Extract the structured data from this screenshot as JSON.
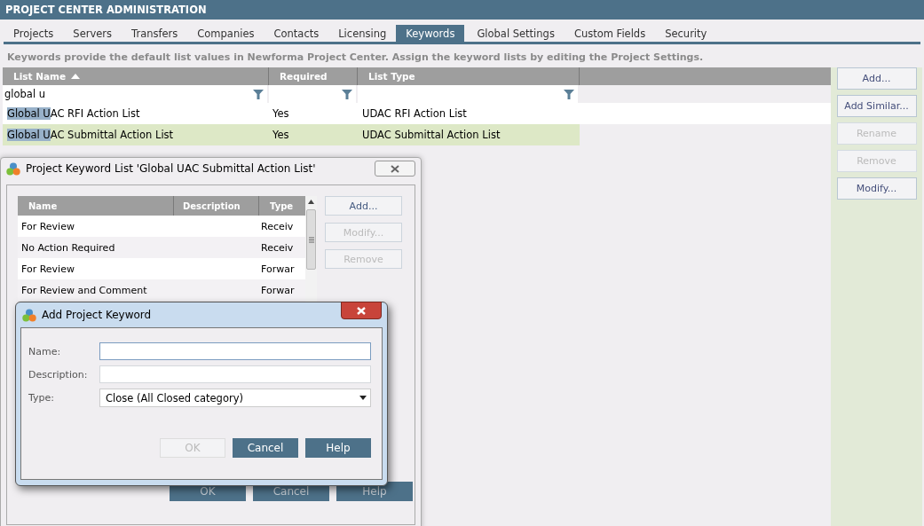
{
  "header": {
    "title": "PROJECT CENTER ADMINISTRATION"
  },
  "tabs": [
    {
      "label": "Projects",
      "selected": false
    },
    {
      "label": "Servers",
      "selected": false
    },
    {
      "label": "Transfers",
      "selected": false
    },
    {
      "label": "Companies",
      "selected": false
    },
    {
      "label": "Contacts",
      "selected": false
    },
    {
      "label": "Licensing",
      "selected": false
    },
    {
      "label": "Keywords",
      "selected": true
    },
    {
      "label": "Global Settings",
      "selected": false
    },
    {
      "label": "Custom Fields",
      "selected": false
    },
    {
      "label": "Security",
      "selected": false
    }
  ],
  "description": "Keywords provide the default list values in Newforma Project Center. Assign the keyword lists by editing the Project Settings.",
  "table": {
    "columns": [
      {
        "label": "List Name",
        "sorted": true,
        "filter": "global u"
      },
      {
        "label": "Required",
        "sorted": false
      },
      {
        "label": "List Type",
        "sorted": false
      }
    ],
    "rows": [
      {
        "selected": false,
        "cells": [
          [
            {
              "text": "Global U",
              "highlighted": true
            },
            {
              "text": "AC RFI Action List",
              "highlighted": false
            }
          ],
          [
            {
              "text": "Yes",
              "highlighted": false
            }
          ],
          [
            {
              "text": "UDAC RFI Action List",
              "highlighted": false
            }
          ]
        ]
      },
      {
        "selected": true,
        "cells": [
          [
            {
              "text": "Global U",
              "highlighted": true
            },
            {
              "text": "AC Submittal Action List",
              "highlighted": false
            }
          ],
          [
            {
              "text": "Yes",
              "highlighted": false
            }
          ],
          [
            {
              "text": "UDAC Submittal Action List",
              "highlighted": false
            }
          ]
        ]
      }
    ]
  },
  "side_buttons": [
    {
      "label": "Add...",
      "disabled": false
    },
    {
      "label": "Add Similar...",
      "disabled": false
    },
    {
      "label": "Rename",
      "disabled": true
    },
    {
      "label": "Remove",
      "disabled": true
    },
    {
      "label": "Modify...",
      "disabled": false
    }
  ],
  "list_dialog": {
    "title": "Project Keyword List 'Global UAC Submittal Action List'",
    "columns": [
      "Name",
      "Description",
      "Type"
    ],
    "rows": [
      {
        "name": "For Review",
        "type": "Receiv"
      },
      {
        "name": "No Action Required",
        "type": "Receiv"
      },
      {
        "name": "For Review",
        "type": "Forwar"
      },
      {
        "name": "For Review and Comment",
        "type": "Forwar"
      }
    ],
    "buttons": [
      {
        "label": "Add...",
        "disabled": false
      },
      {
        "label": "Modify...",
        "disabled": true
      },
      {
        "label": "Remove",
        "disabled": true
      }
    ],
    "footer_buttons": [
      {
        "label": "OK"
      },
      {
        "label": "Cancel"
      },
      {
        "label": "Help"
      }
    ]
  },
  "add_dialog": {
    "title": "Add Project Keyword",
    "fields": [
      {
        "label": "Name:",
        "kind": "text"
      },
      {
        "label": "Description:",
        "kind": "text"
      },
      {
        "label": "Type:",
        "kind": "select",
        "value": "Close (All Closed category)"
      }
    ],
    "buttons": [
      {
        "label": "OK",
        "disabled": true
      },
      {
        "label": "Cancel",
        "disabled": false
      },
      {
        "label": "Help",
        "disabled": false
      }
    ]
  }
}
